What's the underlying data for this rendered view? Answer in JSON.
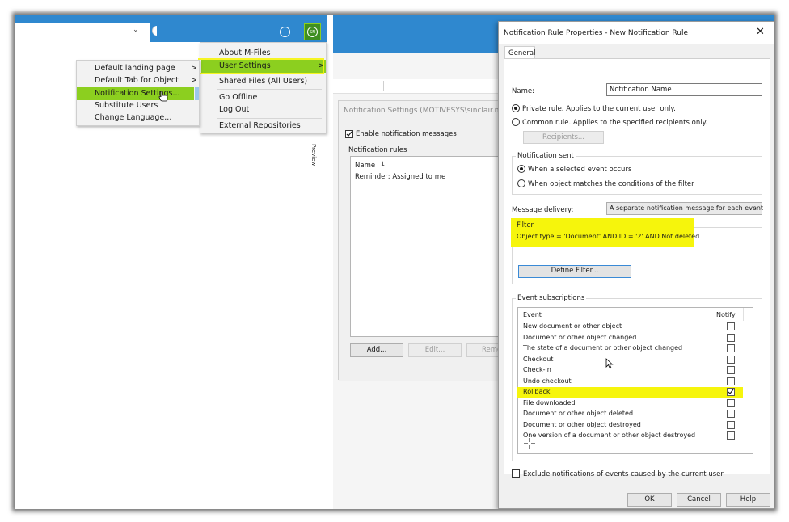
{
  "left_app": {
    "avatar_initials": "SN",
    "add_icon": "plus-circle-icon",
    "dropdown_icon": "chevron-down-icon",
    "user_menu": {
      "items": [
        {
          "label": "About M-Files"
        },
        {
          "label": "User Settings",
          "arrow": ">"
        },
        {
          "label": "Shared Files (All Users)"
        },
        {
          "label": "Go Offline"
        },
        {
          "label": "Log Out"
        },
        {
          "label": "External Repositories"
        }
      ]
    },
    "settings_submenu": {
      "items": [
        {
          "label": "Default landing page",
          "arrow": ">"
        },
        {
          "label": "Default Tab for Object",
          "arrow": ">"
        },
        {
          "label": "Notification Settings..."
        },
        {
          "label": "Substitute Users"
        },
        {
          "label": "Change Language..."
        }
      ]
    },
    "preview_tab": "Preview"
  },
  "notification_settings": {
    "title": "Notification Settings (MOTIVESYS\\sinclair.nga",
    "enable_label": "Enable notification messages",
    "rules_label": "Notification rules",
    "column_name": "Name",
    "sort_icon": "down-arrow-icon",
    "rules": [
      "Reminder: Assigned to me"
    ],
    "add_button": "Add...",
    "edit_button": "Edit...",
    "remove_button": "Remo"
  },
  "dialog": {
    "title": "Notification Rule Properties - New Notification Rule",
    "close_icon": "close-icon",
    "tab_general": "General",
    "name_label": "Name:",
    "name_value": "Notification Name",
    "private_rule": "Private rule. Applies to the current user only.",
    "common_rule": "Common rule. Applies to the specified recipients only.",
    "recipients_button": "Recipients...",
    "notification_sent_label": "Notification sent",
    "when_event": "When a selected event occurs",
    "when_object": "When object matches the conditions of the filter",
    "message_delivery_label": "Message delivery:",
    "message_delivery_value": "A separate notification message for each event",
    "filter_label": "Filter",
    "filter_text": "Object type = 'Document' AND ID = '2' AND Not deleted",
    "define_filter_button": "Define Filter...",
    "event_subscriptions_label": "Event subscriptions",
    "col_event": "Event",
    "col_notify": "Notify",
    "events": [
      {
        "label": "New document or other object",
        "checked": false
      },
      {
        "label": "Document or other object changed",
        "checked": false
      },
      {
        "label": "The state of a document or other object changed",
        "checked": false
      },
      {
        "label": "Checkout",
        "checked": false
      },
      {
        "label": "Check-in",
        "checked": false
      },
      {
        "label": "Undo checkout",
        "checked": false
      },
      {
        "label": "Rollback",
        "checked": true
      },
      {
        "label": "File downloaded",
        "checked": false
      },
      {
        "label": "Document or other object deleted",
        "checked": false
      },
      {
        "label": "Document or other object destroyed",
        "checked": false
      },
      {
        "label": "One version of a document or other object destroyed",
        "checked": false
      }
    ],
    "exclude_label": "Exclude notifications of events caused by the current user",
    "ok_button": "OK",
    "cancel_button": "Cancel",
    "help_button": "Help"
  },
  "colors": {
    "accent_blue": "#2f88cf",
    "highlight_green": "#8ccf1f",
    "highlight_yellow": "#f6f50c"
  }
}
